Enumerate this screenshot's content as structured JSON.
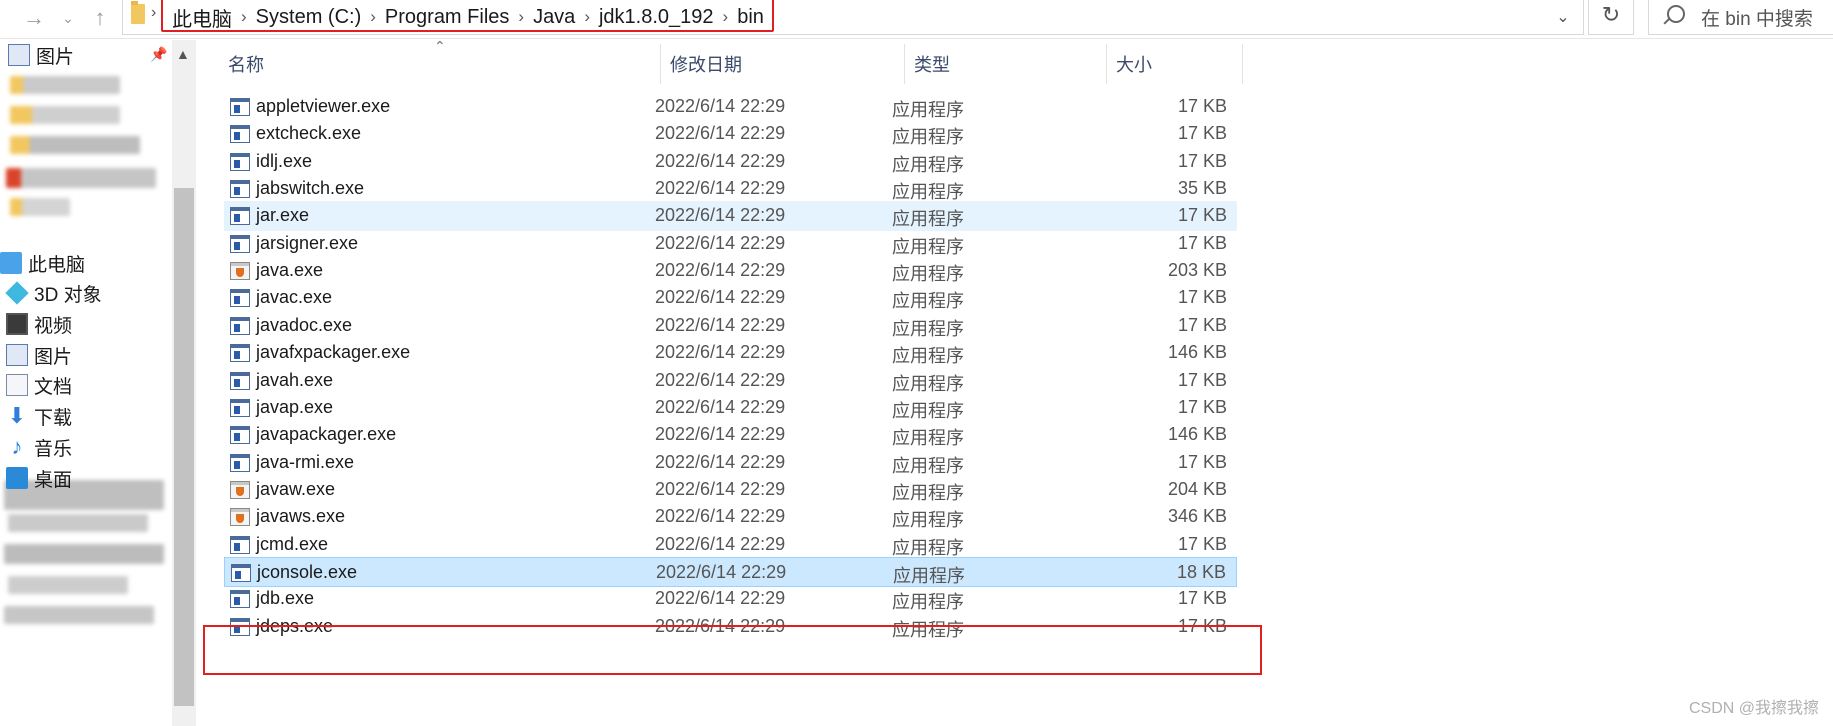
{
  "addressbar": {
    "breadcrumbs": [
      "此电脑",
      "System (C:)",
      "Program Files",
      "Java",
      "jdk1.8.0_192",
      "bin"
    ],
    "search_placeholder": "在 bin 中搜索"
  },
  "sidebar": {
    "pinned_label": "图片",
    "items": [
      {
        "label": "此电脑",
        "icon": "computer-icon"
      },
      {
        "label": "3D 对象",
        "icon": "cube-icon"
      },
      {
        "label": "视频",
        "icon": "video-icon"
      },
      {
        "label": "图片",
        "icon": "picture-icon"
      },
      {
        "label": "文档",
        "icon": "document-icon"
      },
      {
        "label": "下载",
        "icon": "download-icon"
      },
      {
        "label": "音乐",
        "icon": "music-icon"
      },
      {
        "label": "桌面",
        "icon": "desktop-icon"
      }
    ]
  },
  "columns": {
    "name": "名称",
    "date": "修改日期",
    "type": "类型",
    "size": "大小"
  },
  "files": [
    {
      "name": "appletviewer.exe",
      "date": "2022/6/14 22:29",
      "type": "应用程序",
      "size": "17 KB",
      "icon": "exe-icon"
    },
    {
      "name": "extcheck.exe",
      "date": "2022/6/14 22:29",
      "type": "应用程序",
      "size": "17 KB",
      "icon": "exe-icon"
    },
    {
      "name": "idlj.exe",
      "date": "2022/6/14 22:29",
      "type": "应用程序",
      "size": "17 KB",
      "icon": "exe-icon"
    },
    {
      "name": "jabswitch.exe",
      "date": "2022/6/14 22:29",
      "type": "应用程序",
      "size": "35 KB",
      "icon": "exe-icon"
    },
    {
      "name": "jar.exe",
      "date": "2022/6/14 22:29",
      "type": "应用程序",
      "size": "17 KB",
      "icon": "exe-icon",
      "state": "hover"
    },
    {
      "name": "jarsigner.exe",
      "date": "2022/6/14 22:29",
      "type": "应用程序",
      "size": "17 KB",
      "icon": "exe-icon"
    },
    {
      "name": "java.exe",
      "date": "2022/6/14 22:29",
      "type": "应用程序",
      "size": "203 KB",
      "icon": "java-icon"
    },
    {
      "name": "javac.exe",
      "date": "2022/6/14 22:29",
      "type": "应用程序",
      "size": "17 KB",
      "icon": "exe-icon"
    },
    {
      "name": "javadoc.exe",
      "date": "2022/6/14 22:29",
      "type": "应用程序",
      "size": "17 KB",
      "icon": "exe-icon"
    },
    {
      "name": "javafxpackager.exe",
      "date": "2022/6/14 22:29",
      "type": "应用程序",
      "size": "146 KB",
      "icon": "exe-icon"
    },
    {
      "name": "javah.exe",
      "date": "2022/6/14 22:29",
      "type": "应用程序",
      "size": "17 KB",
      "icon": "exe-icon"
    },
    {
      "name": "javap.exe",
      "date": "2022/6/14 22:29",
      "type": "应用程序",
      "size": "17 KB",
      "icon": "exe-icon"
    },
    {
      "name": "javapackager.exe",
      "date": "2022/6/14 22:29",
      "type": "应用程序",
      "size": "146 KB",
      "icon": "exe-icon"
    },
    {
      "name": "java-rmi.exe",
      "date": "2022/6/14 22:29",
      "type": "应用程序",
      "size": "17 KB",
      "icon": "exe-icon"
    },
    {
      "name": "javaw.exe",
      "date": "2022/6/14 22:29",
      "type": "应用程序",
      "size": "204 KB",
      "icon": "java-icon"
    },
    {
      "name": "javaws.exe",
      "date": "2022/6/14 22:29",
      "type": "应用程序",
      "size": "346 KB",
      "icon": "java-icon"
    },
    {
      "name": "jcmd.exe",
      "date": "2022/6/14 22:29",
      "type": "应用程序",
      "size": "17 KB",
      "icon": "exe-icon"
    },
    {
      "name": "jconsole.exe",
      "date": "2022/6/14 22:29",
      "type": "应用程序",
      "size": "18 KB",
      "icon": "exe-icon",
      "state": "selected"
    },
    {
      "name": "jdb.exe",
      "date": "2022/6/14 22:29",
      "type": "应用程序",
      "size": "17 KB",
      "icon": "exe-icon"
    },
    {
      "name": "jdeps.exe",
      "date": "2022/6/14 22:29",
      "type": "应用程序",
      "size": "17 KB",
      "icon": "exe-icon"
    }
  ],
  "watermark": "CSDN @我擦我擦",
  "colors": {
    "highlight_box": "#e02020",
    "selected_row": "#cce8ff",
    "hover_row": "#e5f3ff"
  }
}
